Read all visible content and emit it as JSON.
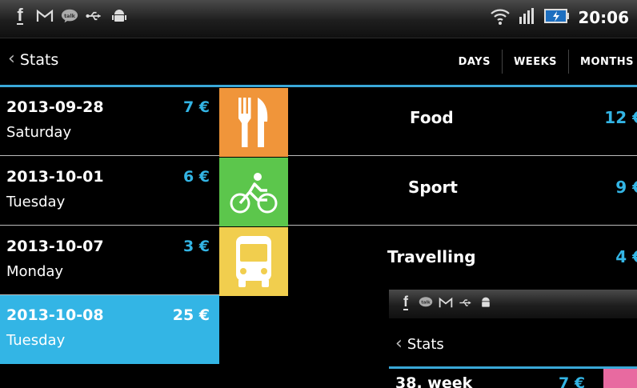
{
  "status_bar": {
    "time": "20:06",
    "icons": [
      "facebook-icon",
      "gmail-icon",
      "talk-icon",
      "usb-icon",
      "android-icon",
      "wifi-icon",
      "signal-icon",
      "battery-icon"
    ]
  },
  "action_bar": {
    "back_label": "Stats",
    "tabs": [
      "DAYS",
      "WEEKS",
      "MONTHS"
    ]
  },
  "days": [
    {
      "date": "2013-09-28",
      "amount": "7 €",
      "weekday": "Saturday"
    },
    {
      "date": "2013-10-01",
      "amount": "6 €",
      "weekday": "Tuesday"
    },
    {
      "date": "2013-10-07",
      "amount": "3 €",
      "weekday": "Monday"
    },
    {
      "date": "2013-10-08",
      "amount": "25 €",
      "weekday": "Tuesday",
      "selected": true
    }
  ],
  "categories": [
    {
      "name": "Food",
      "amount": "12 €",
      "icon": "fork-knife-icon",
      "color": "#f0953a"
    },
    {
      "name": "Sport",
      "amount": "9 €",
      "icon": "bicycle-icon",
      "color": "#5cc64c"
    },
    {
      "name": "Travelling",
      "amount": "4 €",
      "icon": "bus-icon",
      "color": "#f1ce4e"
    }
  ],
  "inset": {
    "back_label": "Stats",
    "row_label": "38. week",
    "row_amount": "7 €"
  },
  "colors": {
    "accent": "#33b5e5",
    "background": "#000000"
  }
}
